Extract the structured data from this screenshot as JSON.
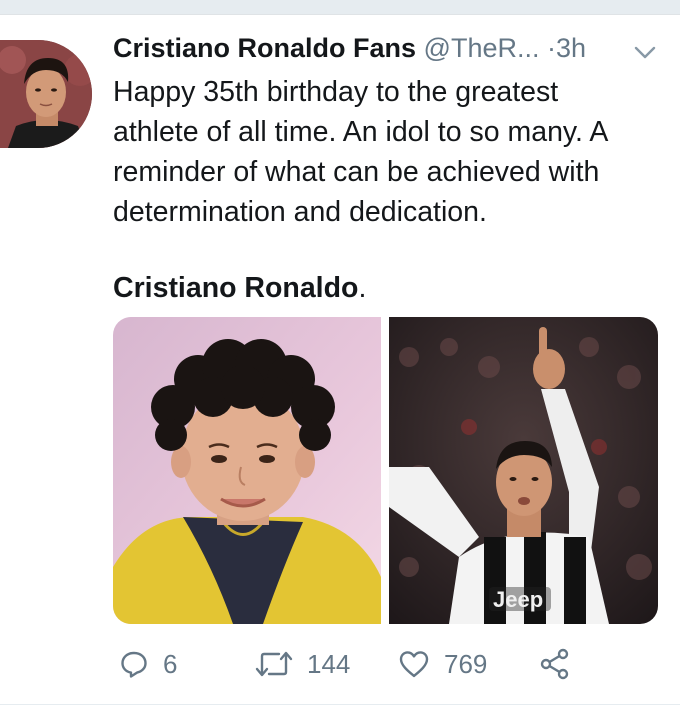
{
  "tweet": {
    "display_name": "Cristiano Ronaldo Fans",
    "handle": "@TheR...",
    "separator": "·",
    "time": "3h",
    "text": "Happy 35th birthday to the greatest\nathlete of all time. An idol to so many.  A\nreminder of what can be achieved with\ndetermination and dedication.",
    "signoff_name": "Cristiano Ronaldo",
    "signoff_period": "."
  },
  "actions": {
    "replies": "6",
    "retweets": "144",
    "likes": "769"
  },
  "icons": {
    "reply": "reply-icon",
    "retweet": "retweet-icon",
    "like": "heart-icon",
    "share": "share-icon",
    "menu": "chevron-down-icon"
  },
  "colors": {
    "text": "#14171a",
    "secondary": "#657786",
    "band": "#e6ecf0"
  }
}
